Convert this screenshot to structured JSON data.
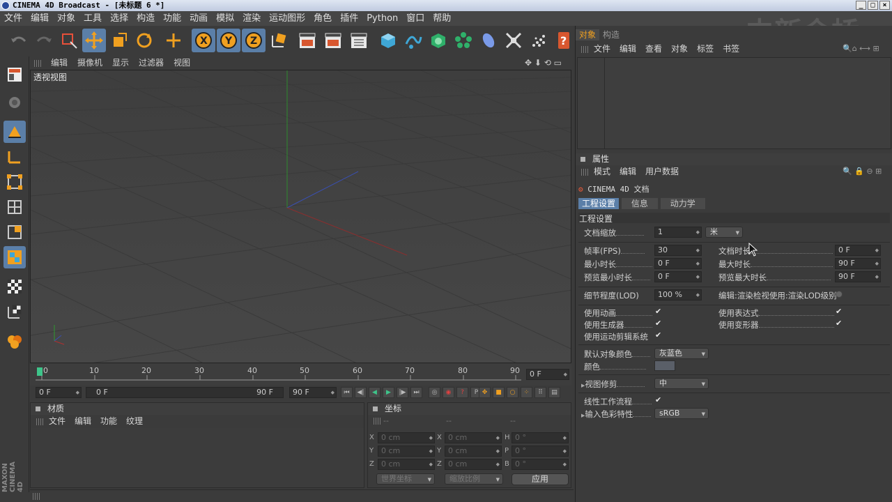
{
  "window": {
    "title": "CINEMA 4D Broadcast - [未标题 6 *]"
  },
  "watermark": "中新金桥",
  "menu": [
    "文件",
    "编辑",
    "对象",
    "工具",
    "选择",
    "构造",
    "功能",
    "动画",
    "模拟",
    "渲染",
    "运动图形",
    "角色",
    "插件",
    "Python",
    "窗口",
    "帮助"
  ],
  "viewport": {
    "menu": [
      "编辑",
      "摄像机",
      "显示",
      "过滤器",
      "视图"
    ],
    "label": "透视视图"
  },
  "timeline": {
    "ticks": [
      "0",
      "10",
      "20",
      "30",
      "40",
      "50",
      "60",
      "70",
      "80",
      "90"
    ],
    "current_frame": "0 F"
  },
  "playbar": {
    "start": "0 F",
    "range_start": "0 F",
    "range_end": "90 F",
    "end": "90 F"
  },
  "material_panel": {
    "title": "材质",
    "menu": [
      "文件",
      "编辑",
      "功能",
      "纹理"
    ]
  },
  "coord_panel": {
    "title": "坐标",
    "headers": [
      "--",
      "--",
      "--"
    ],
    "rows": [
      {
        "a": "X",
        "av": "0 cm",
        "b": "X",
        "bv": "0 cm",
        "c": "H",
        "cv": "0 °"
      },
      {
        "a": "Y",
        "av": "0 cm",
        "b": "Y",
        "bv": "0 cm",
        "c": "P",
        "cv": "0 °"
      },
      {
        "a": "Z",
        "av": "0 cm",
        "b": "Z",
        "bv": "0 cm",
        "c": "B",
        "cv": "0 °"
      }
    ],
    "world_coords": "世界坐标",
    "scale": "缩放比例",
    "apply": "应用"
  },
  "object_panel": {
    "tabs": [
      "对象",
      "构造"
    ],
    "menu": [
      "文件",
      "编辑",
      "查看",
      "对象",
      "标签",
      "书签"
    ]
  },
  "attr_panel": {
    "title": "属性",
    "menu": [
      "模式",
      "编辑",
      "用户数据"
    ],
    "doc_title": "CINEMA 4D 文档",
    "tabs": [
      "工程设置",
      "信息",
      "动力学"
    ],
    "section": "工程设置",
    "doc_scale_label": "文档缩放",
    "doc_scale_value": "1",
    "doc_scale_unit": "米",
    "fps_label": "帧率(FPS)",
    "fps_value": "30",
    "doc_time_label": "文档时长",
    "doc_time_value": "0 F",
    "min_time_label": "最小时长",
    "min_time_value": "0 F",
    "max_time_label": "最大时长",
    "max_time_value": "90 F",
    "prev_min_label": "预览最小时长",
    "prev_min_value": "0 F",
    "prev_max_label": "预览最大时长",
    "prev_max_value": "90 F",
    "lod_label": "细节程度(LOD)",
    "lod_value": "100 %",
    "lod_editor_label": "编辑:渲染检视使用:渲染LOD级别",
    "use_anim": "使用动画",
    "use_expr": "使用表达式",
    "use_gen": "使用生成器",
    "use_deform": "使用变形器",
    "use_motion": "使用运动剪辑系统",
    "def_color_label": "默认对象颜色",
    "def_color_value": "灰蓝色",
    "color_label": "颜色",
    "view_clip_label": "视图修剪",
    "view_clip_value": "中",
    "linear_label": "线性工作流程",
    "input_color_label": "输入色彩特性",
    "input_color_value": "sRGB",
    "check": "✔"
  },
  "brand": "MAXON CINEMA 4D",
  "colors": {
    "accent": "#5b7fa8",
    "panel": "#3b3b3b",
    "viewport": "#444444"
  }
}
